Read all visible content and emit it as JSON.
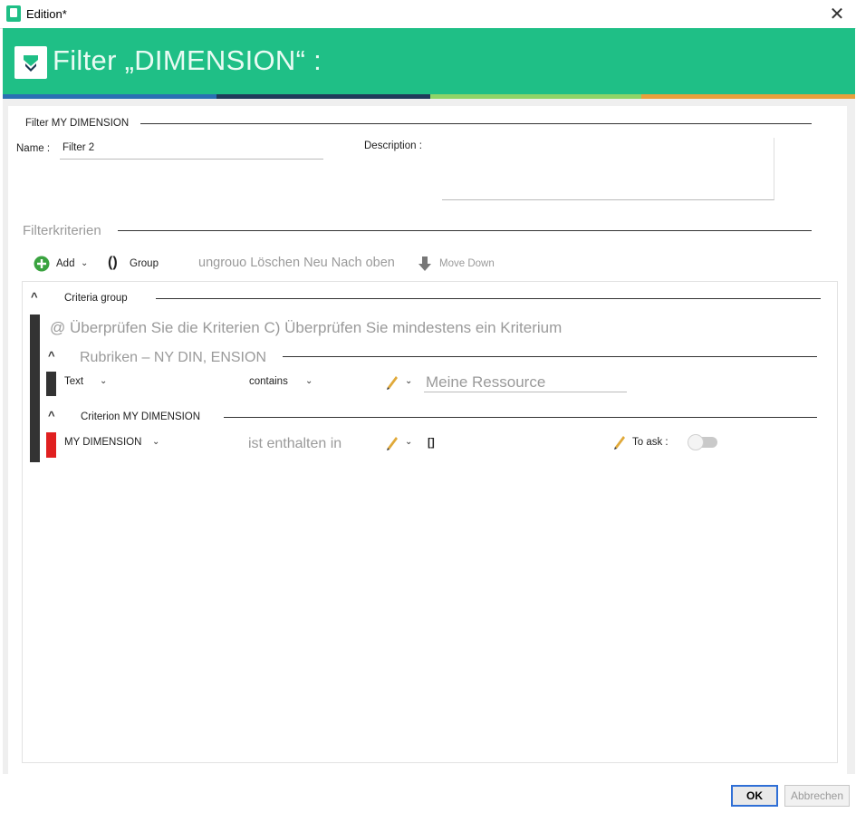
{
  "window": {
    "title": "Edition*",
    "close_glyph": "✕"
  },
  "header": {
    "title": "Filter „DIMENSION“ :",
    "logo_icon": "funnel-logo-icon",
    "brand_color": "#1fbf86"
  },
  "filter_section": {
    "legend": "Filter MY DIMENSION",
    "name_label": "Name :",
    "name_value": "Filter 2",
    "description_label": "Description :",
    "description_value": ""
  },
  "criteria_section": {
    "legend": "Filterkriterien"
  },
  "toolbar": {
    "add_label": "Add",
    "group_label": "Group",
    "overlay_text": "ungrouo Löschen Neu Nach oben",
    "move_down_label": "Move Down"
  },
  "criteria_group": {
    "title": "Criteria group",
    "check_text": "@ Überprüfen Sie die Kriterien C) Überprüfen Sie mindestens ein Kriterium",
    "rubrik": {
      "title": "Rubriken – NY DIN, ENSION",
      "field": "Text",
      "operator": "contains",
      "value": "Meine Ressource"
    },
    "criterion": {
      "title": "Criterion MY DIMENSION",
      "field": "MY DIMENSION",
      "operator": "ist enthalten in",
      "value": "[]",
      "to_ask_label": "To ask :",
      "to_ask_enabled": false
    }
  },
  "footer": {
    "ok_label": "OK",
    "cancel_label": "Abbrechen"
  },
  "colors": {
    "accent": "#1fbf86",
    "stripe_blue": "#2a6fb3",
    "stripe_dark": "#1f3b5a",
    "stripe_green": "#8fd468",
    "stripe_orange": "#e8a03c",
    "criterion_marker": "#e02020"
  }
}
